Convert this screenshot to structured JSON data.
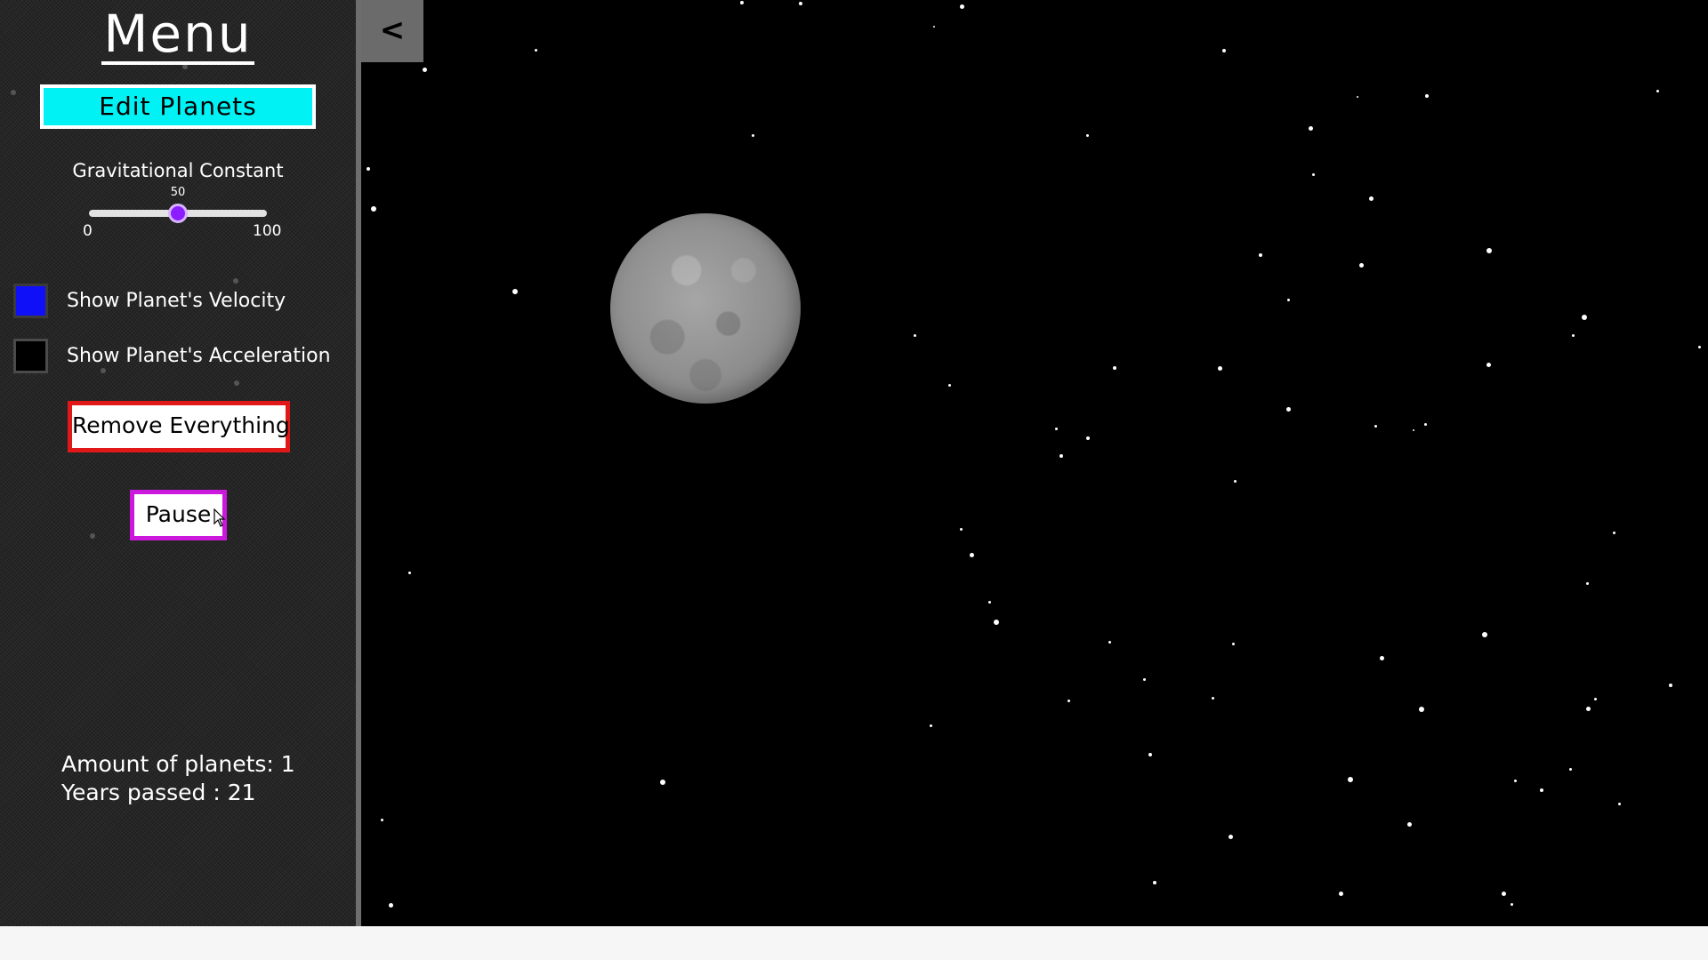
{
  "sidebar": {
    "title": "Menu",
    "edit_planets_label": "Edit Planets",
    "gravity": {
      "label": "Gravitational Constant",
      "value": "50",
      "min": "0",
      "max": "100",
      "fraction": 0.5
    },
    "options": [
      {
        "label": "Show Planet's Velocity",
        "checked": true,
        "color": "#1010f8"
      },
      {
        "label": "Show Planet's Acceleration",
        "checked": false,
        "color": "#000000"
      }
    ],
    "remove_label": "Remove Everything",
    "pause_label": "Pause",
    "stats": {
      "planets": "Amount of planets: 1",
      "years": "Years passed : 21"
    }
  },
  "collapse": {
    "label": "<"
  },
  "colors": {
    "edit_button": "#00f2f4",
    "remove_border": "#e01818",
    "pause_border": "#cc17dd",
    "slider_thumb": "#8b1dff",
    "sidebar_bg": "#262626",
    "space_bg": "#000000"
  },
  "icons": {
    "collapse": "chevron-left-icon",
    "cursor": "mouse-pointer-icon"
  }
}
